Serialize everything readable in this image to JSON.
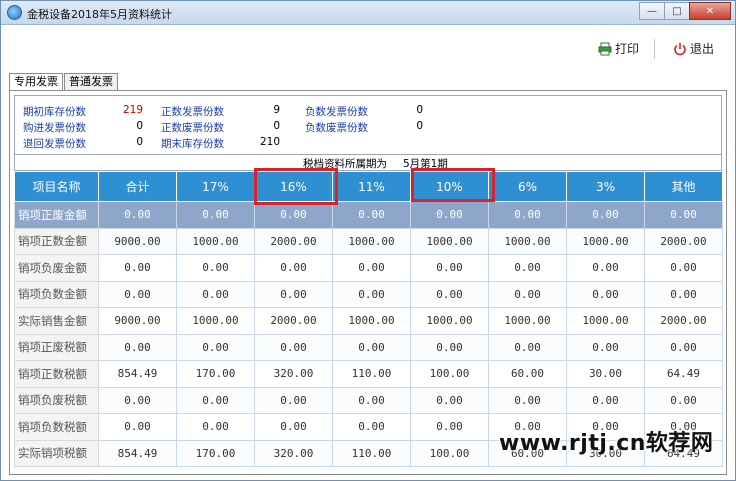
{
  "window": {
    "title": "金税设备2018年5月资料统计",
    "controls": {
      "minimize": "—",
      "maximize": "□",
      "close": "✕"
    }
  },
  "toolbar": {
    "print_label": "打印",
    "exit_label": "退出",
    "print_icon": "printer-icon",
    "exit_icon": "power-icon"
  },
  "tabs": [
    {
      "label": "专用发票",
      "active": true
    },
    {
      "label": "普通发票",
      "active": false
    }
  ],
  "summary": {
    "rows": [
      [
        {
          "label": "期初库存份数",
          "value": "219",
          "red": true
        },
        {
          "label": "正数发票份数",
          "value": "9"
        },
        {
          "label": "负数发票份数",
          "value": "0"
        }
      ],
      [
        {
          "label": "购进发票份数",
          "value": "0"
        },
        {
          "label": "正数废票份数",
          "value": "0"
        },
        {
          "label": "负数废票份数",
          "value": "0"
        }
      ],
      [
        {
          "label": "退回发票份数",
          "value": "0"
        },
        {
          "label": "期末库存份数",
          "value": "210"
        }
      ]
    ]
  },
  "period": {
    "label": "税档资料所属期为",
    "value": "5月第1期"
  },
  "table": {
    "columns": [
      "项目名称",
      "合计",
      "17%",
      "16%",
      "11%",
      "10%",
      "6%",
      "3%",
      "其他"
    ],
    "highlighted_columns": [
      "16%",
      "10%"
    ],
    "rows": [
      {
        "name": "销项正废金额",
        "values": [
          "0.00",
          "0.00",
          "0.00",
          "0.00",
          "0.00",
          "0.00",
          "0.00",
          "0.00"
        ],
        "selected": true
      },
      {
        "name": "销项正数金额",
        "values": [
          "9000.00",
          "1000.00",
          "2000.00",
          "1000.00",
          "1000.00",
          "1000.00",
          "1000.00",
          "2000.00"
        ]
      },
      {
        "name": "销项负废金额",
        "values": [
          "0.00",
          "0.00",
          "0.00",
          "0.00",
          "0.00",
          "0.00",
          "0.00",
          "0.00"
        ]
      },
      {
        "name": "销项负数金额",
        "values": [
          "0.00",
          "0.00",
          "0.00",
          "0.00",
          "0.00",
          "0.00",
          "0.00",
          "0.00"
        ]
      },
      {
        "name": "实际销售金额",
        "values": [
          "9000.00",
          "1000.00",
          "2000.00",
          "1000.00",
          "1000.00",
          "1000.00",
          "1000.00",
          "2000.00"
        ]
      },
      {
        "name": "销项正废税额",
        "values": [
          "0.00",
          "0.00",
          "0.00",
          "0.00",
          "0.00",
          "0.00",
          "0.00",
          "0.00"
        ]
      },
      {
        "name": "销项正数税额",
        "values": [
          "854.49",
          "170.00",
          "320.00",
          "110.00",
          "100.00",
          "60.00",
          "30.00",
          "64.49"
        ]
      },
      {
        "name": "销项负废税额",
        "values": [
          "0.00",
          "0.00",
          "0.00",
          "0.00",
          "0.00",
          "0.00",
          "0.00",
          "0.00"
        ]
      },
      {
        "name": "销项负数税额",
        "values": [
          "0.00",
          "0.00",
          "0.00",
          "0.00",
          "0.00",
          "0.00",
          "0.00",
          "0.00"
        ]
      },
      {
        "name": "实际销项税额",
        "values": [
          "854.49",
          "170.00",
          "320.00",
          "110.00",
          "100.00",
          "60.00",
          "30.00",
          "64.49"
        ]
      }
    ]
  },
  "watermark": "www.rjtj.cn软荐网",
  "colors": {
    "header_bg": "#2f8fd3",
    "selected_row": "#8ea6c9",
    "highlight": "#d8232a",
    "label_blue": "#1b3fa0"
  }
}
